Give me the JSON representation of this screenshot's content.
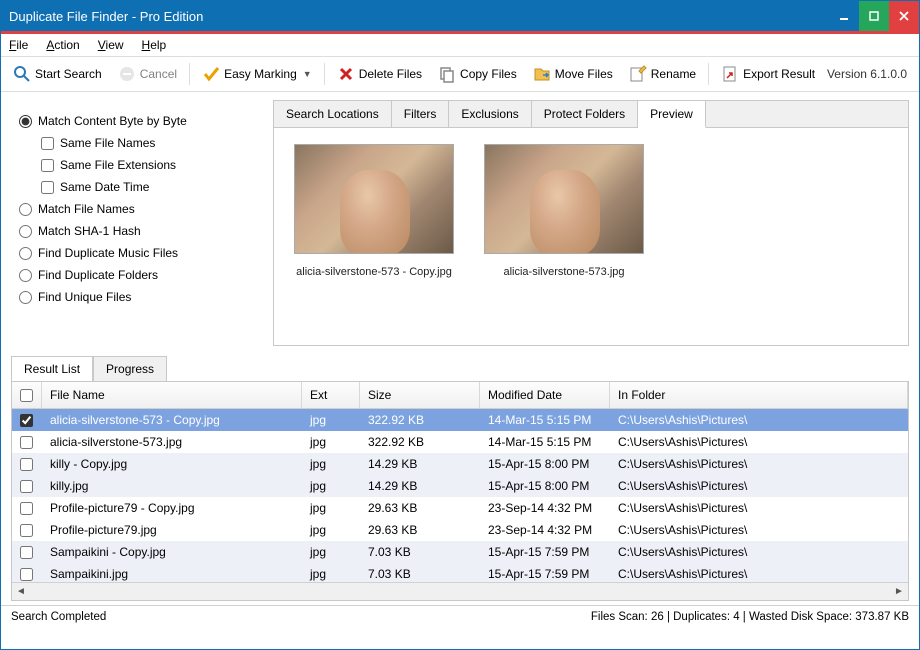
{
  "window": {
    "title": "Duplicate File Finder - Pro Edition"
  },
  "menu": {
    "file": "File",
    "action": "Action",
    "view": "View",
    "help": "Help"
  },
  "toolbar": {
    "start": "Start Search",
    "cancel": "Cancel",
    "easy_marking": "Easy Marking",
    "delete": "Delete Files",
    "copy": "Copy Files",
    "move": "Move Files",
    "rename": "Rename",
    "export": "Export Result",
    "version": "Version 6.1.0.0"
  },
  "options": {
    "match_content": "Match Content Byte by Byte",
    "same_names": "Same File Names",
    "same_ext": "Same File Extensions",
    "same_date": "Same Date Time",
    "match_names": "Match File Names",
    "match_sha1": "Match SHA-1 Hash",
    "find_music": "Find Duplicate Music Files",
    "find_folders": "Find Duplicate Folders",
    "find_unique": "Find Unique Files"
  },
  "right_tabs": {
    "locations": "Search Locations",
    "filters": "Filters",
    "exclusions": "Exclusions",
    "protect": "Protect Folders",
    "preview": "Preview"
  },
  "preview": {
    "items": [
      {
        "caption": "alicia-silverstone-573 - Copy.jpg"
      },
      {
        "caption": "alicia-silverstone-573.jpg"
      }
    ]
  },
  "result_tabs": {
    "list": "Result List",
    "progress": "Progress"
  },
  "grid": {
    "headers": {
      "name": "File Name",
      "ext": "Ext",
      "size": "Size",
      "date": "Modified Date",
      "folder": "In Folder"
    },
    "rows": [
      {
        "checked": true,
        "selected": true,
        "alt": false,
        "name": "alicia-silverstone-573 - Copy.jpg",
        "ext": "jpg",
        "size": "322.92 KB",
        "date": "14-Mar-15 5:15 PM",
        "folder": "C:\\Users\\Ashis\\Pictures\\"
      },
      {
        "checked": false,
        "selected": false,
        "alt": false,
        "name": "alicia-silverstone-573.jpg",
        "ext": "jpg",
        "size": "322.92 KB",
        "date": "14-Mar-15 5:15 PM",
        "folder": "C:\\Users\\Ashis\\Pictures\\"
      },
      {
        "checked": false,
        "selected": false,
        "alt": true,
        "name": "killy - Copy.jpg",
        "ext": "jpg",
        "size": "14.29 KB",
        "date": "15-Apr-15 8:00 PM",
        "folder": "C:\\Users\\Ashis\\Pictures\\"
      },
      {
        "checked": false,
        "selected": false,
        "alt": true,
        "name": "killy.jpg",
        "ext": "jpg",
        "size": "14.29 KB",
        "date": "15-Apr-15 8:00 PM",
        "folder": "C:\\Users\\Ashis\\Pictures\\"
      },
      {
        "checked": false,
        "selected": false,
        "alt": false,
        "name": "Profile-picture79 - Copy.jpg",
        "ext": "jpg",
        "size": "29.63 KB",
        "date": "23-Sep-14 4:32 PM",
        "folder": "C:\\Users\\Ashis\\Pictures\\"
      },
      {
        "checked": false,
        "selected": false,
        "alt": false,
        "name": "Profile-picture79.jpg",
        "ext": "jpg",
        "size": "29.63 KB",
        "date": "23-Sep-14 4:32 PM",
        "folder": "C:\\Users\\Ashis\\Pictures\\"
      },
      {
        "checked": false,
        "selected": false,
        "alt": true,
        "name": "Sampaikini - Copy.jpg",
        "ext": "jpg",
        "size": "7.03 KB",
        "date": "15-Apr-15 7:59 PM",
        "folder": "C:\\Users\\Ashis\\Pictures\\"
      },
      {
        "checked": false,
        "selected": false,
        "alt": true,
        "name": "Sampaikini.jpg",
        "ext": "jpg",
        "size": "7.03 KB",
        "date": "15-Apr-15 7:59 PM",
        "folder": "C:\\Users\\Ashis\\Pictures\\"
      }
    ]
  },
  "status": {
    "left": "Search Completed",
    "right": "Files Scan:  26 | Duplicates:  4 | Wasted Disk Space:  373.87 KB"
  }
}
